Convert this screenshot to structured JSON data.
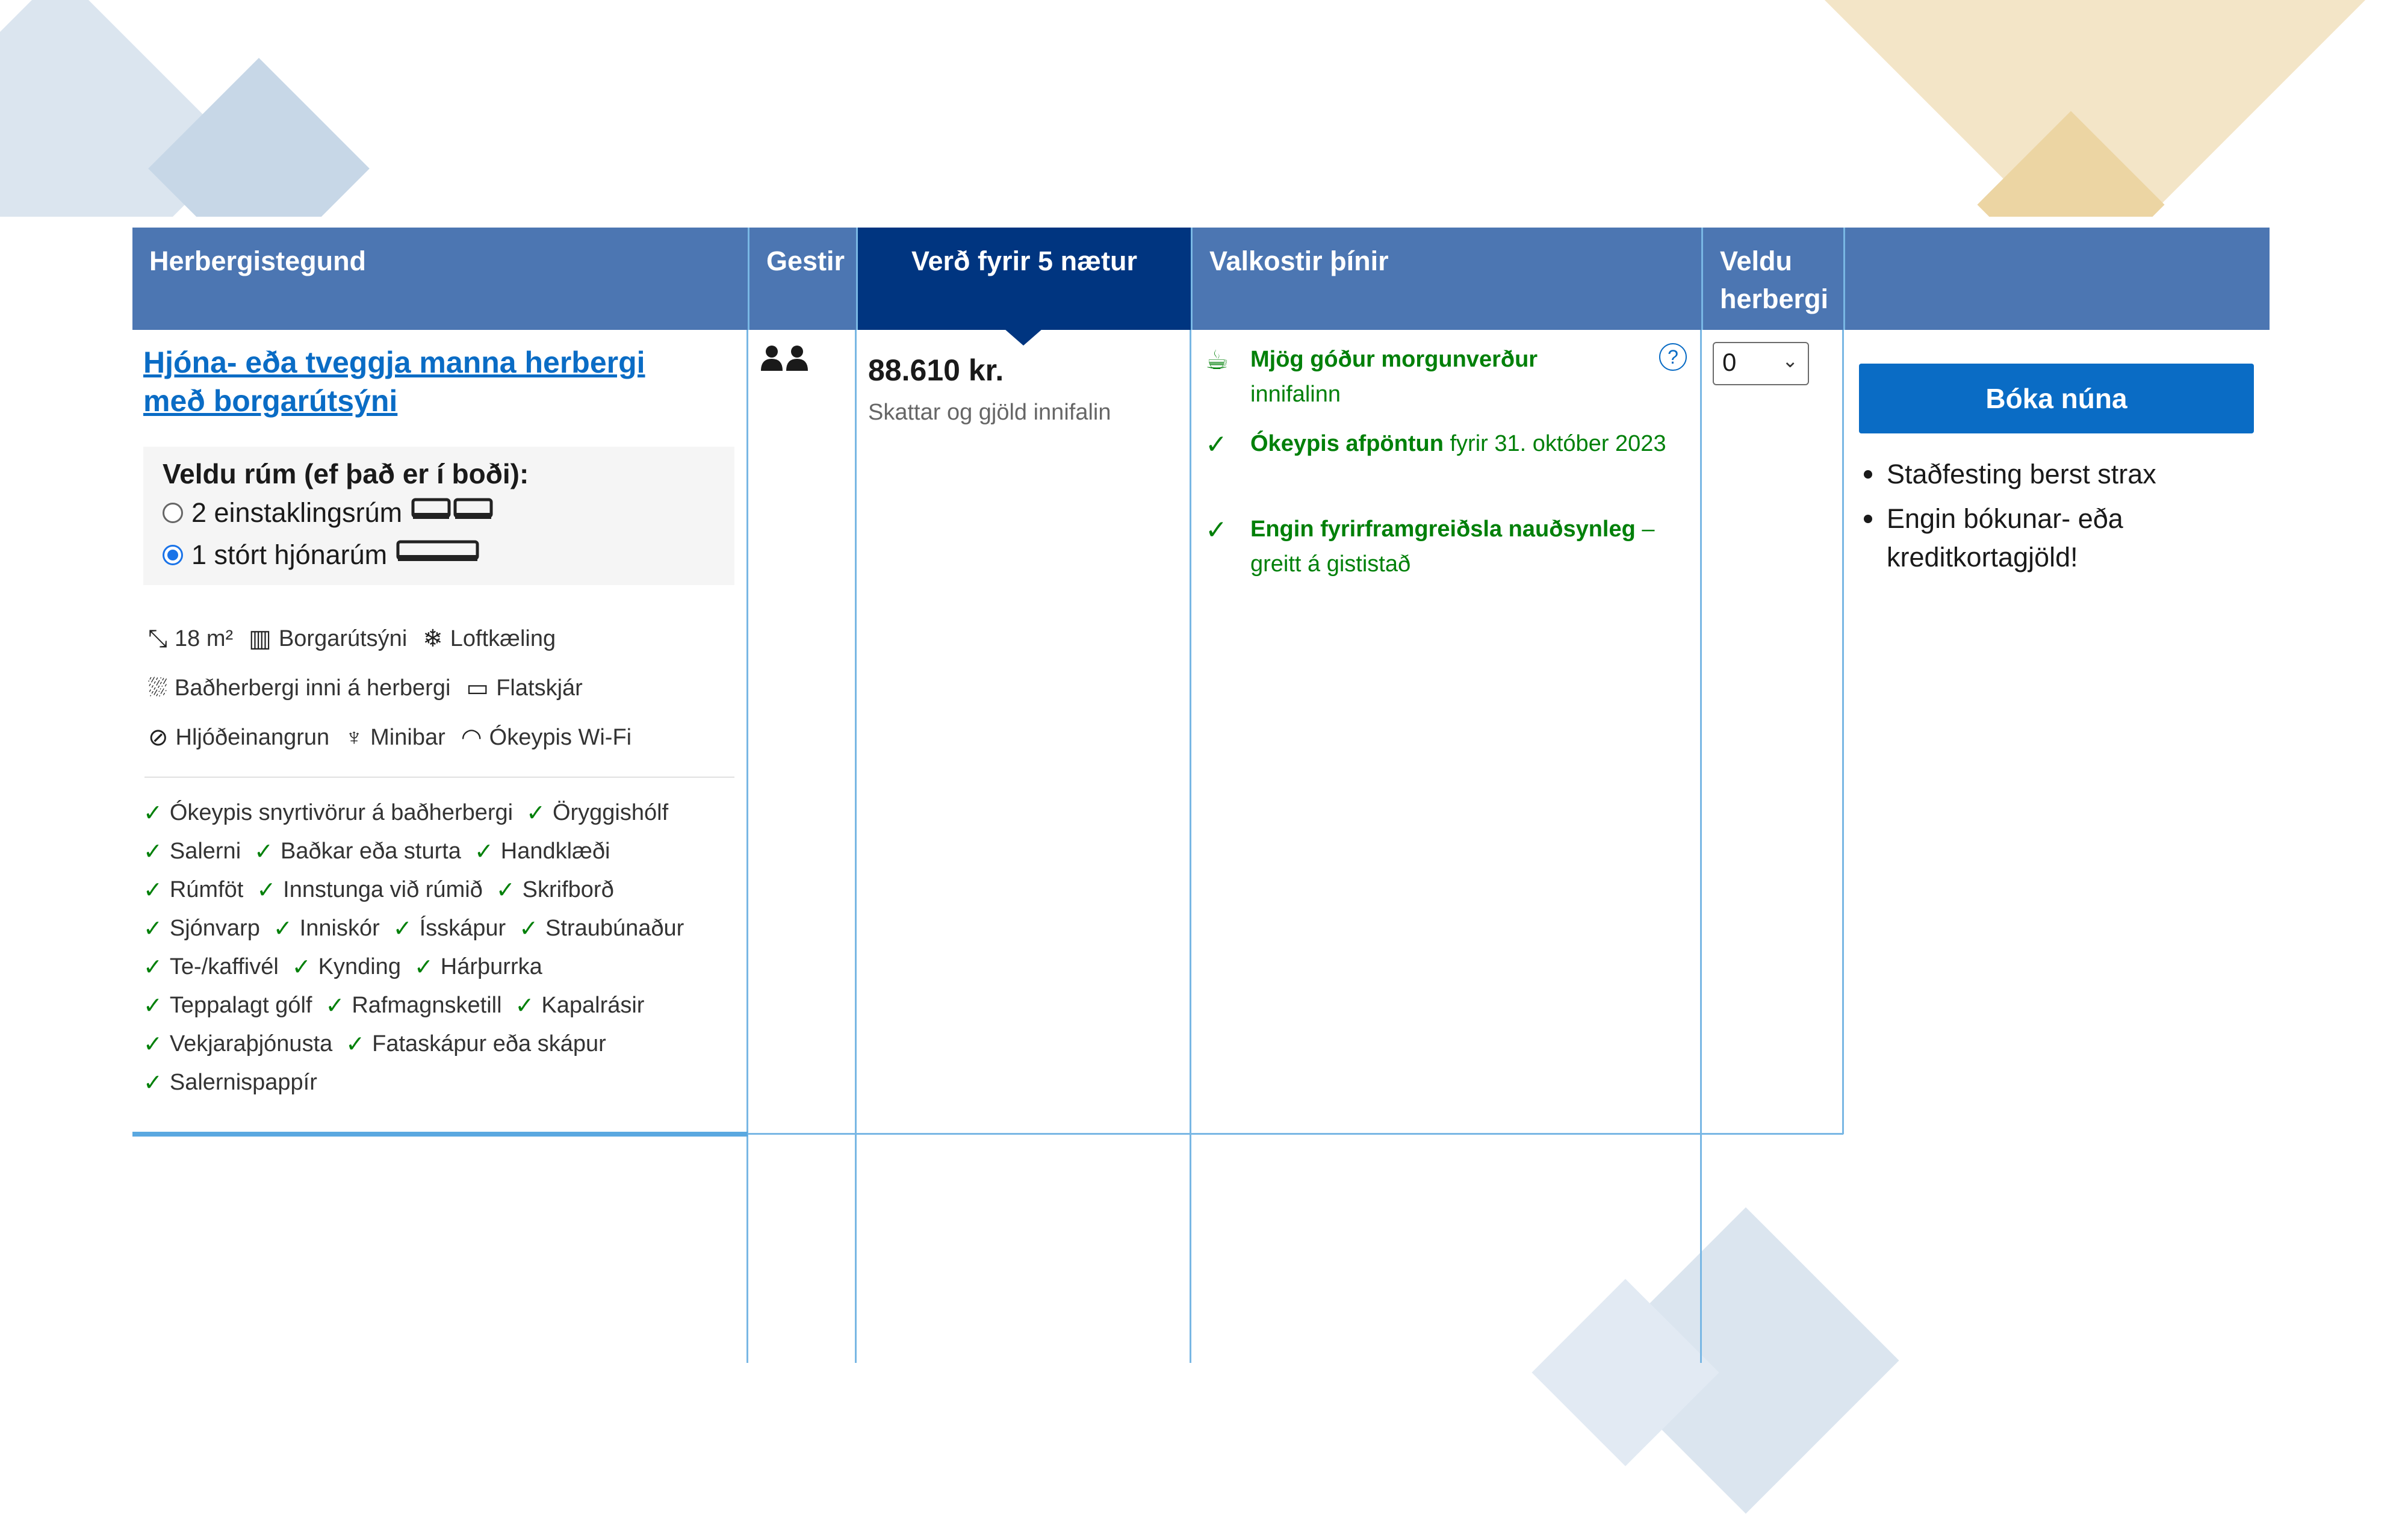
{
  "headers": {
    "room_type": "Herbergistegund",
    "guests": "Gestir",
    "price": "Verð fyrir 5 nætur",
    "options": "Valkostir þínir",
    "select_rooms": "Veldu herbergi"
  },
  "room": {
    "name": "Hjóna- eða tveggja manna herbergi með borgarútsýni",
    "bed_title": "Veldu rúm (ef það er í boði):",
    "bed_options": [
      {
        "label": "2 einstaklingsrúm",
        "selected": false
      },
      {
        "label": "1 stórt hjónarúm",
        "selected": true
      }
    ],
    "facilities": [
      [
        {
          "icon": "size-icon",
          "label": "18 m²"
        },
        {
          "icon": "building-icon",
          "label": "Borgarútsýni"
        },
        {
          "icon": "snowflake-icon",
          "label": "Loftkæling"
        }
      ],
      [
        {
          "icon": "bath-icon",
          "label": "Baðherbergi inni á herbergi"
        },
        {
          "icon": "tv-icon",
          "label": "Flatskjár"
        }
      ],
      [
        {
          "icon": "soundproof-icon",
          "label": "Hljóðeinangrun"
        },
        {
          "icon": "minibar-icon",
          "label": "Minibar"
        },
        {
          "icon": "wifi-icon",
          "label": "Ókeypis Wi-Fi"
        }
      ]
    ],
    "amenities": [
      [
        "Ókeypis snyrtivörur á baðherbergi",
        "Öryggishólf"
      ],
      [
        "Salerni",
        "Baðkar eða sturta",
        "Handklæði"
      ],
      [
        "Rúmföt",
        "Innstunga við rúmið",
        "Skrifborð"
      ],
      [
        "Sjónvarp",
        "Inniskór",
        "Ísskápur",
        "Straubúnaður"
      ],
      [
        "Te-/kaffivél",
        "Kynding",
        "Hárþurrka"
      ],
      [
        "Teppalagt gólf",
        "Rafmagnsketill",
        "Kapalrásir"
      ],
      [
        "Vekjaraþjónusta",
        "Fataskápur eða skápur"
      ],
      [
        "Salernispappír"
      ]
    ]
  },
  "price": {
    "amount": "88.610 kr.",
    "note": "Skattar og gjöld innifalin"
  },
  "options": {
    "breakfast_bold": "Mjög góður morgunverður",
    "breakfast_rest": "innifalinn",
    "cancel_bold": "Ókeypis afpöntun",
    "cancel_rest": "fyrir 31. október 2023",
    "prepay_bold": "Engin fyrirframgreiðsla nauðsynleg",
    "prepay_rest": "– greitt á gististað",
    "help_glyph": "?"
  },
  "select": {
    "value": "0"
  },
  "booking": {
    "button_label": "Bóka núna",
    "bullets": [
      "Staðfesting berst strax",
      "Engin bókunar- eða kreditkortagjöld!"
    ]
  },
  "colors": {
    "header": "#4c76b2",
    "header_dark": "#003580",
    "accent": "#0a6cc5",
    "green": "#008009"
  }
}
